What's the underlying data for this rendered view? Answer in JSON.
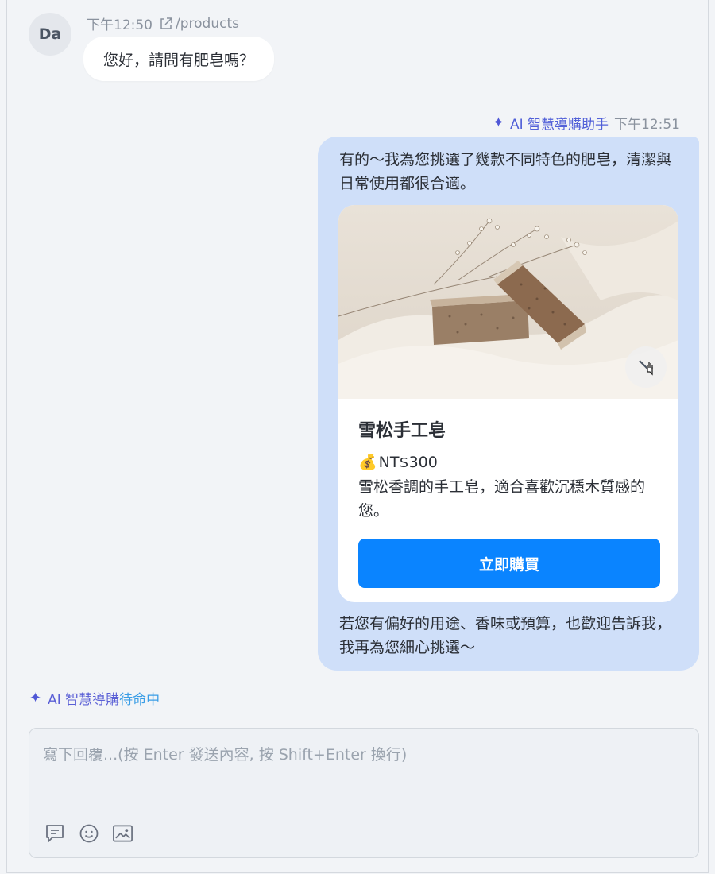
{
  "user_message": {
    "avatar_initials": "Da",
    "time": "下午12:50",
    "page_link": "/products",
    "text": "您好，請問有肥皂嗎？"
  },
  "assistant_message": {
    "name": "AI 智慧導購助手",
    "time": "下午12:51",
    "intro": "有的～我為您挑選了幾款不同特色的肥皂，清潔與日常使用都很合適。",
    "product": {
      "image_icon": "soap-bars-photo",
      "title": "雪松手工皂",
      "price_emoji": "💰",
      "price": "NT$300",
      "description": "雪松香調的手工皂，適合喜歡沉穩木質感的您。",
      "buy_label": "立即購買"
    },
    "outro": "若您有偏好的用途、香味或預算，也歡迎告訴我，我再為您細心挑選～"
  },
  "status": {
    "label_main": "AI 智慧導購",
    "label_state": "待命中"
  },
  "composer": {
    "placeholder": "寫下回覆...(按 Enter 發送內容, 按 Shift+Enter 換行)"
  },
  "colors": {
    "accent": "#0a84ff",
    "ai_bubble": "#cfdff9",
    "ai_name": "#5160d8"
  }
}
